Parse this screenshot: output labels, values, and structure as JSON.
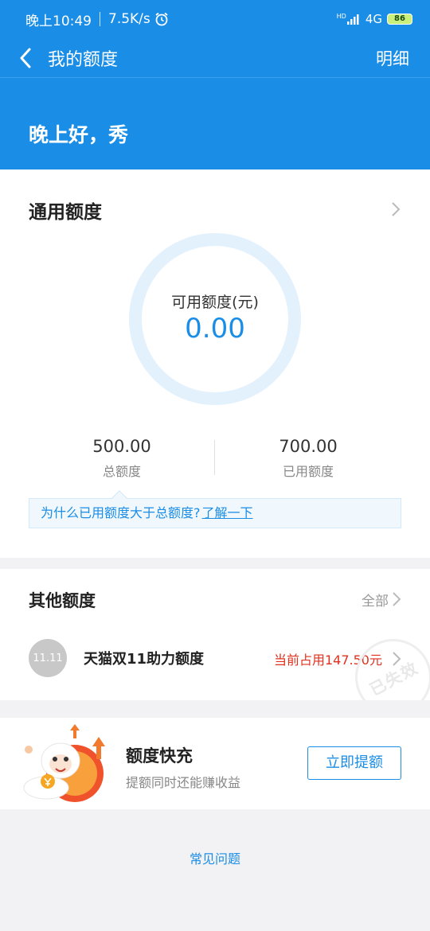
{
  "status_bar": {
    "time": "晚上10:49",
    "speed": "7.5K/s",
    "network": "4G",
    "hd": "HD",
    "battery": "86"
  },
  "nav": {
    "title": "我的额度",
    "right": "明细"
  },
  "hero": {
    "greeting": "晚上好，秀"
  },
  "general": {
    "title": "通用额度",
    "available_label": "可用额度(元)",
    "available_value": "0.00",
    "total_value": "500.00",
    "total_label": "总额度",
    "used_value": "700.00",
    "used_label": "已用额度",
    "tip_text": "为什么已用额度大于总额度?",
    "tip_link": "了解一下"
  },
  "other": {
    "title": "其他额度",
    "all_label": "全部",
    "items": [
      {
        "name": "天猫双11助力额度",
        "used": "当前占用147.50元",
        "icon_text": "11.11",
        "stamp": "已失效"
      }
    ]
  },
  "promo": {
    "title": "额度快充",
    "subtitle": "提额同时还能赚收益",
    "button": "立即提额"
  },
  "faq": "常见问题",
  "colors": {
    "primary": "#1a8de6",
    "warning": "#e0301e"
  }
}
